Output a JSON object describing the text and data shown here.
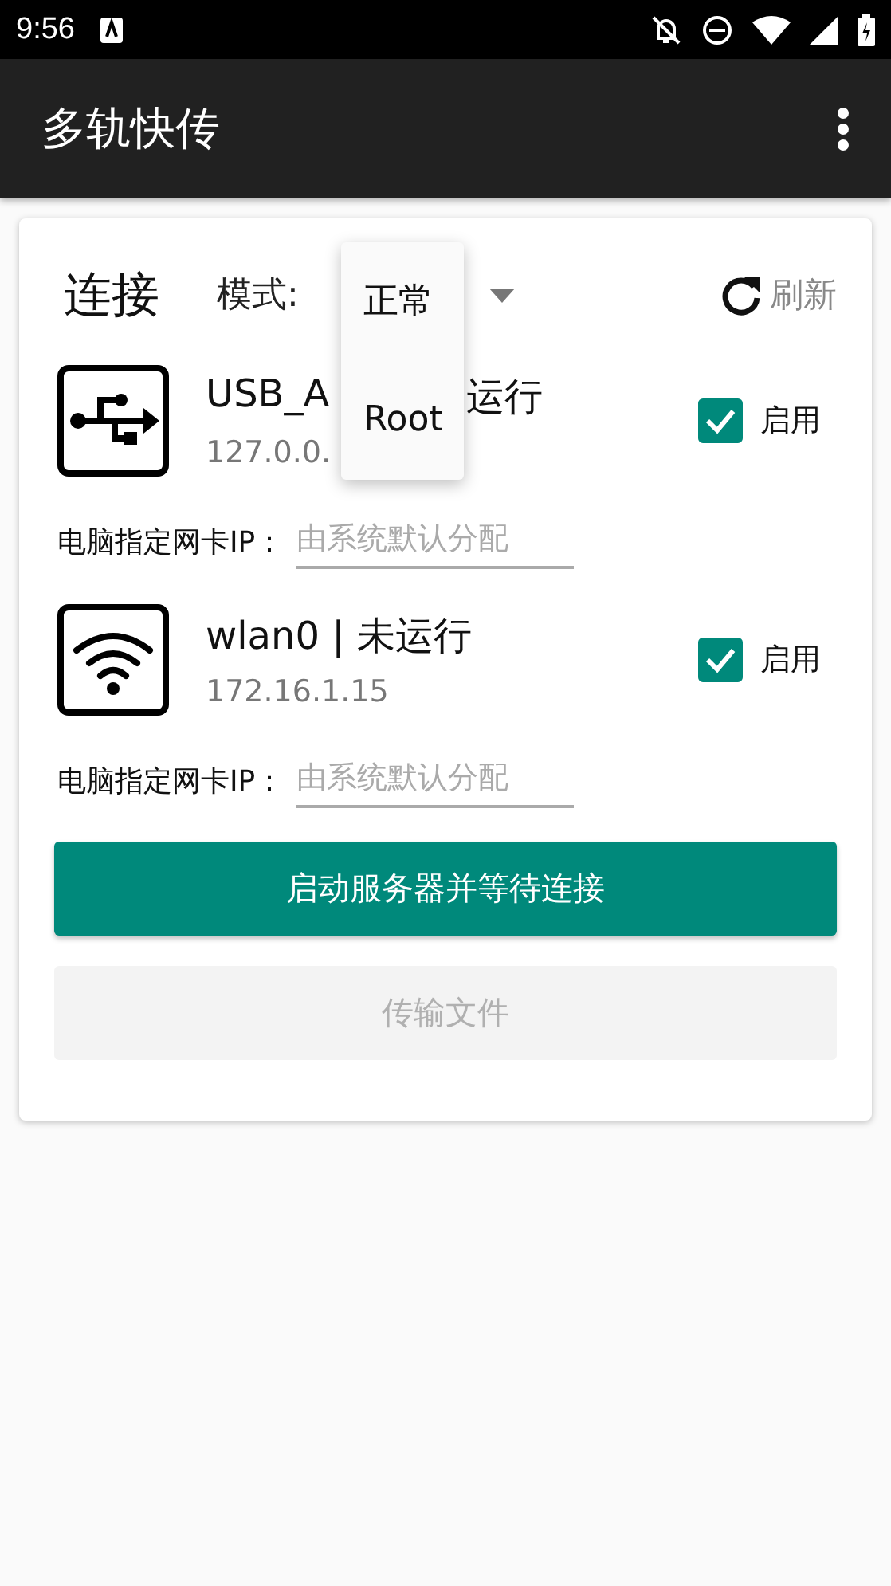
{
  "status_bar": {
    "time": "9:56"
  },
  "app_bar": {
    "title": "多轨快传"
  },
  "card": {
    "title": "连接",
    "mode_label": "模式:",
    "refresh": "刷新",
    "devices": [
      {
        "kind": "usb",
        "title": "USB_A",
        "title_tail": "运行",
        "ip": "127.0.0.",
        "enabled": true,
        "enable_label": "启用",
        "ip_label": "电脑指定网卡IP：",
        "ip_placeholder": "由系统默认分配"
      },
      {
        "kind": "wifi",
        "title": "wlan0 | 未运行",
        "ip": "172.16.1.15",
        "enabled": true,
        "enable_label": "启用",
        "ip_label": "电脑指定网卡IP：",
        "ip_placeholder": "由系统默认分配"
      }
    ],
    "buttons": [
      {
        "label": "启动服务器并等待连接",
        "disabled": false
      },
      {
        "label": "传输文件",
        "disabled": true
      }
    ]
  },
  "mode_menu": {
    "options": [
      "正常",
      "Root"
    ]
  }
}
